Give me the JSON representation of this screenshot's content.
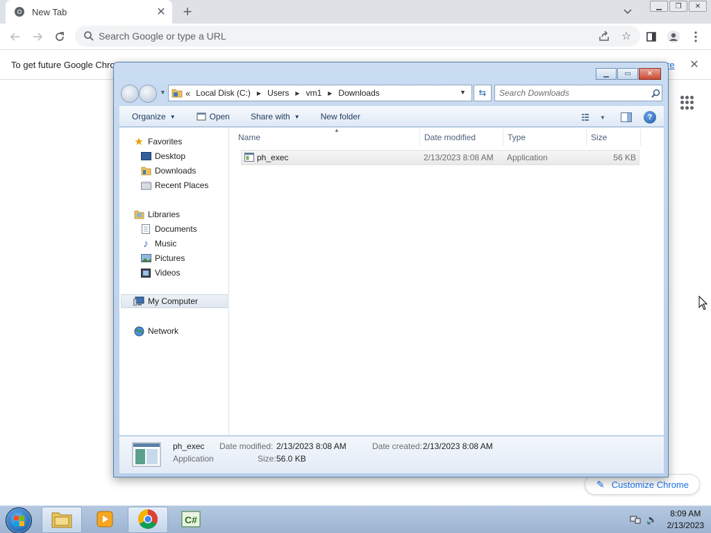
{
  "browser": {
    "tab_title": "New Tab",
    "omnibox_placeholder": "Search Google or type a URL",
    "infobar_text": "To get future Google Chro",
    "infobar_link": "re",
    "customize_label": "Customize Chrome"
  },
  "explorer": {
    "breadcrumb": [
      "Local Disk (C:)",
      "Users",
      "vm1",
      "Downloads"
    ],
    "breadcrumb_overflow": "«",
    "search_placeholder": "Search Downloads",
    "commands": {
      "organize": "Organize",
      "open": "Open",
      "share_with": "Share with",
      "new_folder": "New folder"
    },
    "nav": {
      "favorites": "Favorites",
      "desktop": "Desktop",
      "downloads": "Downloads",
      "recent_places": "Recent Places",
      "libraries": "Libraries",
      "documents": "Documents",
      "music": "Music",
      "pictures": "Pictures",
      "videos": "Videos",
      "my_computer": "My Computer",
      "network": "Network"
    },
    "columns": {
      "name": "Name",
      "date_modified": "Date modified",
      "type": "Type",
      "size": "Size"
    },
    "files": [
      {
        "name": "ph_exec",
        "date_modified": "2/13/2023 8:08 AM",
        "type": "Application",
        "size": "56 KB"
      }
    ],
    "details": {
      "name": "ph_exec",
      "type": "Application",
      "date_modified_label": "Date modified:",
      "date_modified": "2/13/2023 8:08 AM",
      "date_created_label": "Date created:",
      "date_created": "2/13/2023 8:08 AM",
      "size_label": "Size:",
      "size": "56.0 KB"
    }
  },
  "taskbar": {
    "time": "8:09 AM",
    "date": "2/13/2023"
  },
  "colors": {
    "chrome_blue": "#1a73e8",
    "explorer_frame": "#c9dcf2",
    "taskbar": "#a9bfd9"
  }
}
